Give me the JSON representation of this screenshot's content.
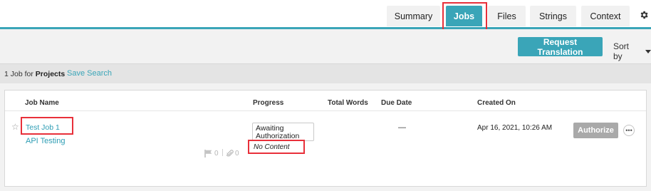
{
  "tabs": [
    {
      "label": "Summary",
      "active": false
    },
    {
      "label": "Jobs",
      "active": true
    },
    {
      "label": "Files",
      "active": false
    },
    {
      "label": "Strings",
      "active": false
    },
    {
      "label": "Context",
      "active": false
    }
  ],
  "icons": {
    "settings": "gear-icon",
    "star": "star-icon",
    "flag": "flag-icon",
    "attachment": "paperclip-icon",
    "more": "ellipsis-icon",
    "sort_caret": "caret-down-icon"
  },
  "actions": {
    "request_translation": "Request Translation",
    "sort_by": "Sort by"
  },
  "filter": {
    "count_prefix": "1 Job for",
    "count_scope": "Projects",
    "save_search": "Save Search"
  },
  "table": {
    "headers": {
      "job_name": "Job Name",
      "progress": "Progress",
      "total_words": "Total Words",
      "due_date": "Due Date",
      "created_on": "Created On"
    },
    "rows": [
      {
        "job_name": "Test Job 1",
        "project": "API Testing",
        "progress_status": "Awaiting Authorization",
        "progress_note": "No Content",
        "total_words": "",
        "due_date": "—",
        "created_on": "Apr 16, 2021, 10:26 AM",
        "authorize_label": "Authorize",
        "more_label": "•••",
        "issues_count": "0",
        "attachments_count": "0"
      }
    ]
  },
  "colors": {
    "accent": "#3aa5b8",
    "highlight": "#e8303a",
    "disabled_button": "#a9a9a9"
  }
}
